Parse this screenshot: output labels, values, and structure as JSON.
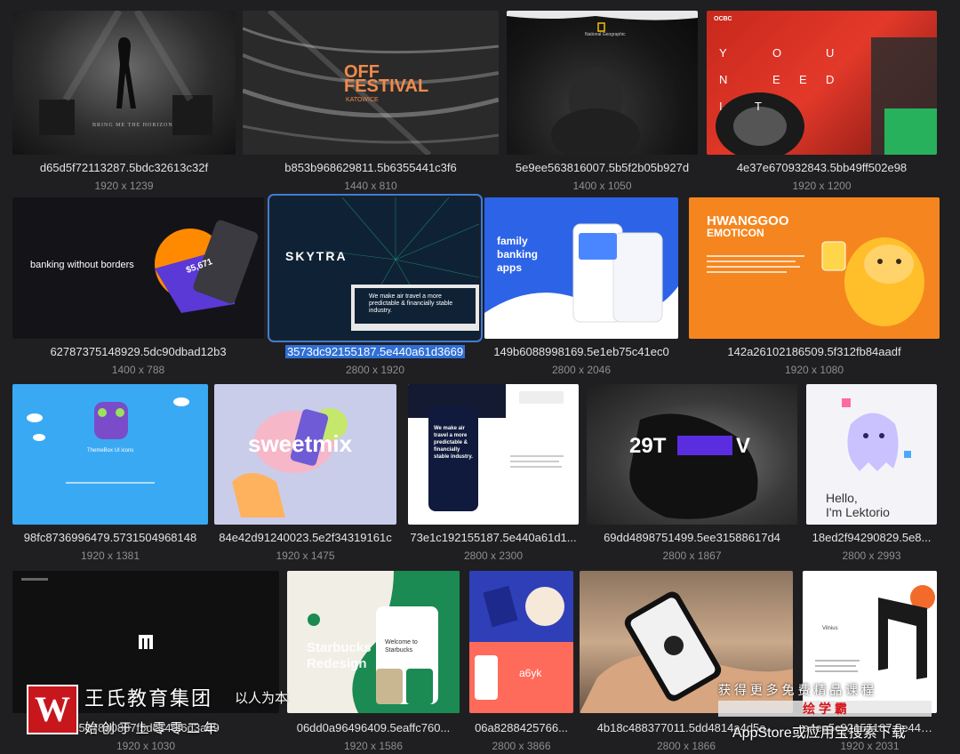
{
  "files": [
    {
      "name": "d65d5f72113287.5bdc32613c32f",
      "dims": "1920 x 1239",
      "caption": "BRING ME THE HORIZON"
    },
    {
      "name": "b853b968629811.5b6355441c3f6",
      "dims": "1440 x 810",
      "title1": "OFF",
      "title2": "FESTIVAL",
      "title3": "KATOWICE"
    },
    {
      "name": "5e9ee563816007.5b5f2b05b927d",
      "dims": "1400 x 1050",
      "brand": "National Geographic"
    },
    {
      "name": "4e37e670932843.5bb49ff502e98",
      "dims": "1920 x 1200",
      "brand": "OCBC",
      "letters": [
        "Y",
        "O",
        "U",
        "N",
        "E",
        "E",
        "D",
        "I",
        "T"
      ]
    },
    {
      "name": "62787375148929.5dc90dbad12b3",
      "dims": "1400 x 788",
      "headline": "banking without borders",
      "card_amount": "$5,671"
    },
    {
      "name": "3573dc92155187.5e440a61d3669",
      "dims": "2800 x 1920",
      "brand": "SKYTRA",
      "tagline": "We make air travel a more predictable & financially stable industry."
    },
    {
      "name": "149b6088998169.5e1eb75c41ec0",
      "dims": "2800 x 2046",
      "headline": "family banking apps"
    },
    {
      "name": "142a26102186509.5f312fb84aadf",
      "dims": "1920 x 1080",
      "title1": "HWANGGOO",
      "title2": "EMOTICON"
    },
    {
      "name": "98fc8736996479.5731504968148",
      "dims": "1920 x 1381",
      "caption": "ThemeBox UI icons"
    },
    {
      "name": "84e42d91240023.5e2f34319161c",
      "dims": "1920 x 1475",
      "brand": "sweetmix"
    },
    {
      "name": "73e1c192155187.5e440a61d1...",
      "dims": "2800 x 2300",
      "headline": "We make air travel a more predictable & financially stable industry."
    },
    {
      "name": "69dd4898751499.5ee31588617d4",
      "dims": "2800 x 1867",
      "brand": "29T",
      "brand_end": "V"
    },
    {
      "name": "18ed2f94290829.5e8...",
      "dims": "2800 x 2993",
      "greeting1": "Hello,",
      "greeting2": "I'm Lektorio"
    },
    {
      "name": "e5878a0887f5dc140f6d3a99",
      "dims": "1920 x 1030"
    },
    {
      "name": "06dd0a96496409.5eaffc760...",
      "dims": "1920 x 1586",
      "title1": "Starbucks",
      "title2": "Redesign",
      "welcome": "Welcome to Starbucks"
    },
    {
      "name": "06a8288425766...",
      "dims": "2800 x 3866",
      "brand": "a6yk"
    },
    {
      "name": "4b18c488377011.5dd4814a4d5a...",
      "dims": "2800 x 1866"
    },
    {
      "name": "a4ea5c92155187.5e440a5f2...",
      "dims": "1920 x 2031",
      "brand": "Vilnius"
    }
  ],
  "watermark": {
    "company": "王氏教育集团",
    "slogan": "以人为本",
    "subline": "始  创  于  上  零  零  二  年",
    "promo1": "获  得  更  多  免  费  精  品  课  程",
    "promo2": "绘 学 霸",
    "promo3": "AppStore或应用宝搜索下载",
    "logo_letter": "W"
  },
  "colors": {
    "bg": "#1f1f21",
    "select": "#3b7ddd",
    "logo_red": "#c8161d"
  }
}
